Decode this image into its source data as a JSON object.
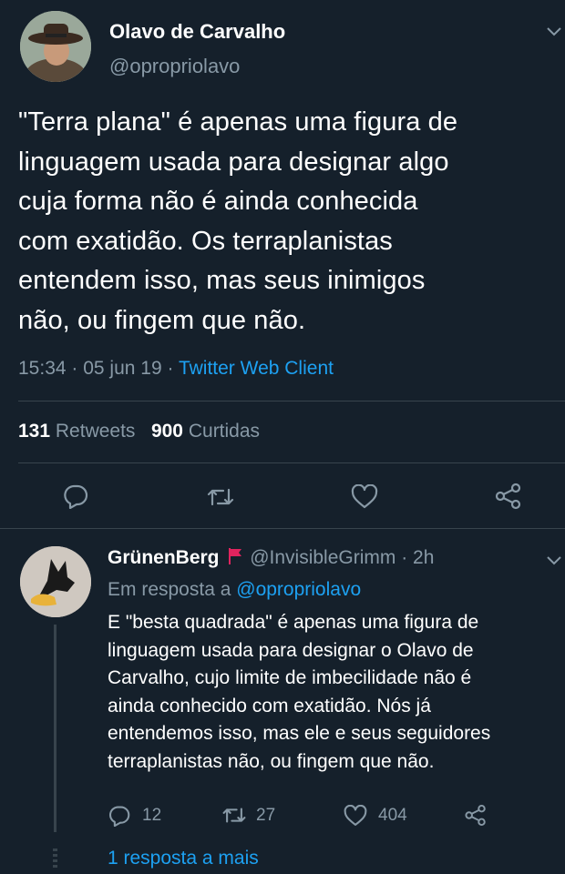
{
  "main_tweet": {
    "author_name": "Olavo de Carvalho",
    "handle": "@opropriolavo",
    "lines": [
      "\"Terra plana\" é apenas uma figura de",
      "linguagem usada para designar algo",
      "cuja forma não é ainda conhecida",
      "com exatidão. Os terraplanistas",
      "entendem isso, mas seus inimigos",
      "não, ou fingem que não."
    ],
    "time": "15:34",
    "date": "05 jun 19",
    "source": "Twitter Web Client",
    "retweets_count": "131",
    "retweets_label": "Retweets",
    "likes_count": "900",
    "likes_label": "Curtidas"
  },
  "reply": {
    "author_name": "GrünenBerg",
    "handle": "@InvisibleGrimm",
    "age": "2h",
    "reply_prefix": "Em resposta a",
    "reply_to": "@opropriolavo",
    "lines": [
      "E \"besta quadrada\" é apenas uma figura de",
      "linguagem usada para designar o Olavo de",
      "Carvalho, cujo limite de imbecilidade não é",
      "ainda conhecido com exatidão. Nós já",
      "entendemos isso, mas ele e seus seguidores",
      "terraplanistas não, ou fingem que não."
    ],
    "replies_count": "12",
    "retweets_count": "27",
    "likes_count": "404",
    "more_replies": "1 resposta a mais"
  },
  "colors": {
    "background": "#15202b",
    "muted": "#8899a6",
    "accent": "#1da1f2",
    "divider": "#38444d",
    "flag": "#e0245e"
  },
  "icons": [
    "chevron-down-icon",
    "reply-icon",
    "retweet-icon",
    "like-icon",
    "share-icon",
    "flag-icon"
  ]
}
